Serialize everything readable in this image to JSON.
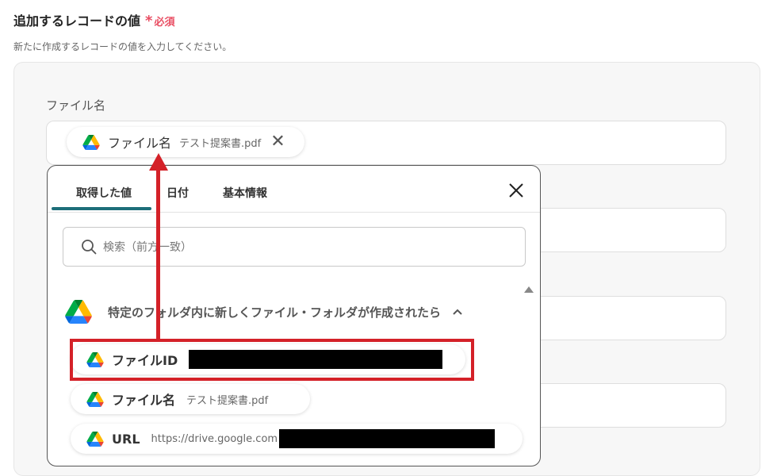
{
  "section": {
    "title": "追加するレコードの値",
    "required_star": "*",
    "required_label": "必須",
    "description": "新たに作成するレコードの値を入力してください。"
  },
  "field": {
    "label": "ファイル名"
  },
  "chip": {
    "icon": "google-drive-icon",
    "name": "ファイル名",
    "value": "テスト提案書.pdf",
    "close_icon": "close-icon"
  },
  "dropdown": {
    "tabs": [
      {
        "label": "取得した値",
        "active": true
      },
      {
        "label": "日付",
        "active": false
      },
      {
        "label": "基本情報",
        "active": false
      }
    ],
    "close_icon": "close-icon",
    "search": {
      "placeholder": "検索（前方一致）",
      "value": "",
      "icon": "search-icon"
    },
    "group": {
      "icon": "google-drive-icon",
      "title": "特定のフォルダ内に新しくファイル・フォルダが作成されたら",
      "chevron": "chevron-up-icon"
    },
    "items": [
      {
        "name": "ファイルID",
        "value": ""
      },
      {
        "name": "ファイル名",
        "value": "テスト提案書.pdf"
      },
      {
        "name": "URL",
        "value": "https://drive.google.com"
      }
    ]
  },
  "colors": {
    "accent": "#1d6e79",
    "required": "#e94e63",
    "annotation": "#d42128"
  }
}
